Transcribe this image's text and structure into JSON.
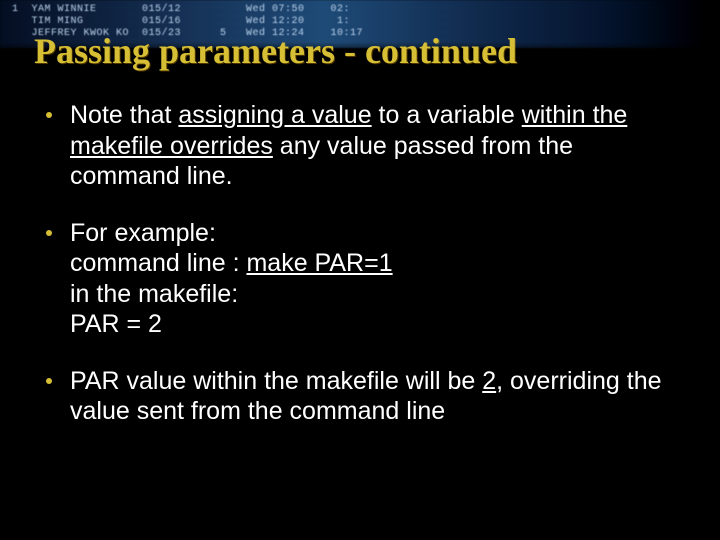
{
  "banner": {
    "line1": "1  YAM WINNIE       015/12          Wed 07:50    02:",
    "line2": "   TIM MING         015/16          Wed 12:20     1:",
    "line3": "   JEFFREY KWOK KO  015/23      5   Wed 12:24    10:17"
  },
  "title": "Passing parameters - continued",
  "bullets": {
    "b1": {
      "p1": "Note that ",
      "u1": "assigning a value",
      "p2": " to a variable ",
      "u2": "within the makefile overrides",
      "p3": " any value passed from the command line."
    },
    "b2": {
      "l1": "For example:",
      "l2a": "command line : ",
      "l2u": "make PAR=1",
      "l3": "in the makefile:",
      "l4": "PAR = 2"
    },
    "b3": {
      "p1": "PAR value within the makefile will be ",
      "u1": "2",
      "p2": ", overriding the value sent from the command line"
    }
  }
}
